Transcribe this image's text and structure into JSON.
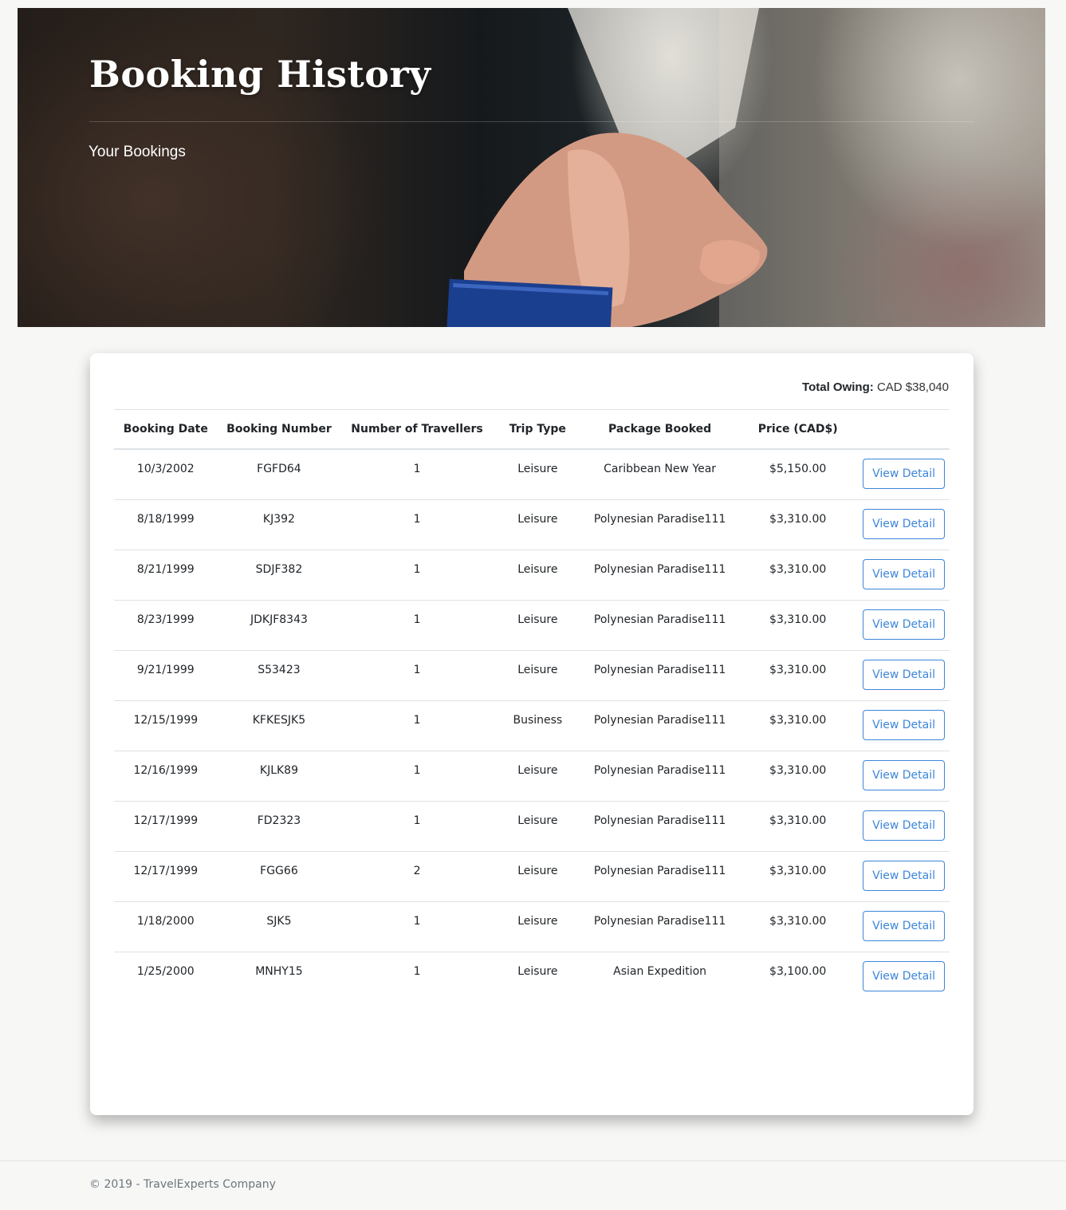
{
  "hero": {
    "title": "Booking History",
    "subtitle": "Your Bookings"
  },
  "summary": {
    "total_label": "Total Owing:",
    "total_value": "CAD $38,040"
  },
  "table": {
    "headers": [
      "Booking Date",
      "Booking Number",
      "Number of Travellers",
      "Trip Type",
      "Package Booked",
      "Price (CAD$)",
      ""
    ],
    "rows": [
      {
        "date": "10/3/2002",
        "number": "FGFD64",
        "travellers": "1",
        "trip_type": "Leisure",
        "package": "Caribbean New Year",
        "price": "$5,150.00",
        "action": "View Detail"
      },
      {
        "date": "8/18/1999",
        "number": "KJ392",
        "travellers": "1",
        "trip_type": "Leisure",
        "package": "Polynesian Paradise111",
        "price": "$3,310.00",
        "action": "View Detail"
      },
      {
        "date": "8/21/1999",
        "number": "SDJF382",
        "travellers": "1",
        "trip_type": "Leisure",
        "package": "Polynesian Paradise111",
        "price": "$3,310.00",
        "action": "View Detail"
      },
      {
        "date": "8/23/1999",
        "number": "JDKJF8343",
        "travellers": "1",
        "trip_type": "Leisure",
        "package": "Polynesian Paradise111",
        "price": "$3,310.00",
        "action": "View Detail"
      },
      {
        "date": "9/21/1999",
        "number": "S53423",
        "travellers": "1",
        "trip_type": "Leisure",
        "package": "Polynesian Paradise111",
        "price": "$3,310.00",
        "action": "View Detail"
      },
      {
        "date": "12/15/1999",
        "number": "KFKESJK5",
        "travellers": "1",
        "trip_type": "Business",
        "package": "Polynesian Paradise111",
        "price": "$3,310.00",
        "action": "View Detail"
      },
      {
        "date": "12/16/1999",
        "number": "KJLK89",
        "travellers": "1",
        "trip_type": "Leisure",
        "package": "Polynesian Paradise111",
        "price": "$3,310.00",
        "action": "View Detail"
      },
      {
        "date": "12/17/1999",
        "number": "FD2323",
        "travellers": "1",
        "trip_type": "Leisure",
        "package": "Polynesian Paradise111",
        "price": "$3,310.00",
        "action": "View Detail"
      },
      {
        "date": "12/17/1999",
        "number": "FGG66",
        "travellers": "2",
        "trip_type": "Leisure",
        "package": "Polynesian Paradise111",
        "price": "$3,310.00",
        "action": "View Detail"
      },
      {
        "date": "1/18/2000",
        "number": "SJK5",
        "travellers": "1",
        "trip_type": "Leisure",
        "package": "Polynesian Paradise111",
        "price": "$3,310.00",
        "action": "View Detail"
      },
      {
        "date": "1/25/2000",
        "number": "MNHY15",
        "travellers": "1",
        "trip_type": "Leisure",
        "package": "Asian Expedition",
        "price": "$3,100.00",
        "action": "View Detail"
      }
    ]
  },
  "footer": {
    "text": "© 2019 - TravelExperts Company"
  },
  "colors": {
    "accent": "#3d86d8",
    "page_background": "#f7f8f6",
    "card_background": "#ffffff"
  }
}
